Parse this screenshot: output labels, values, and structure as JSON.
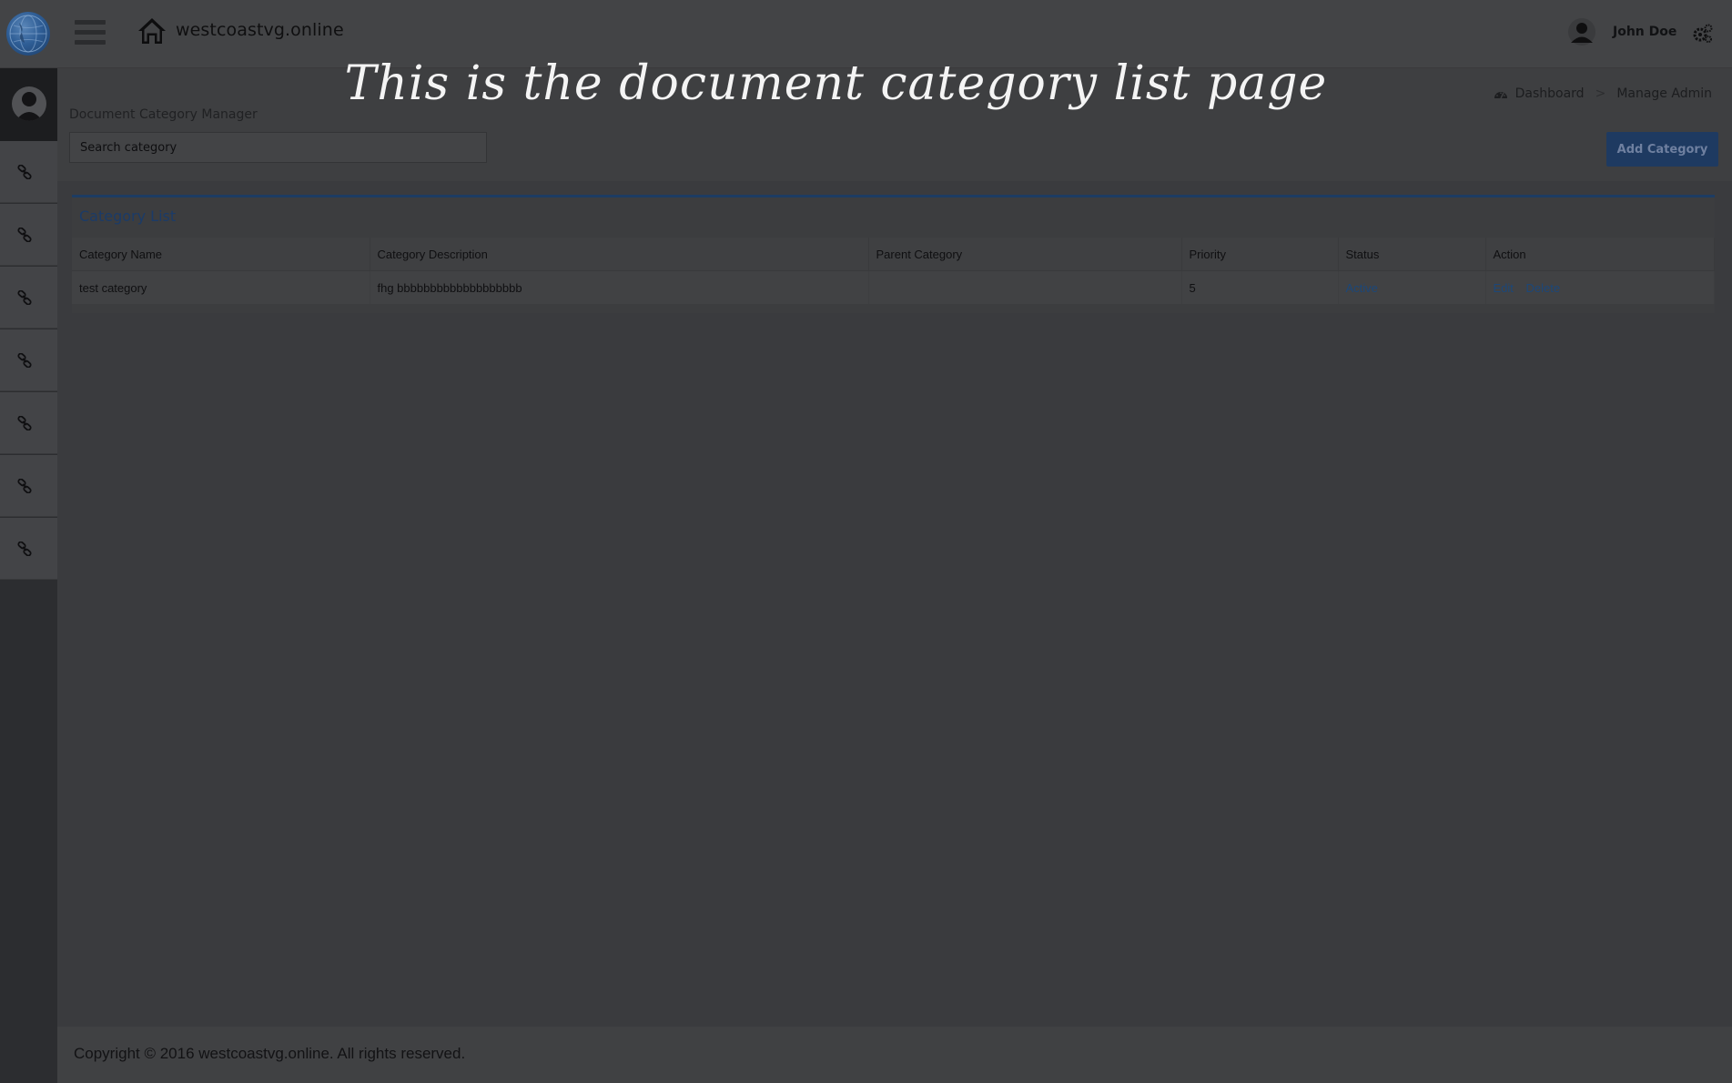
{
  "topbar": {
    "site_title": "westcoastvg.online",
    "user_name": "John Doe"
  },
  "overlay": {
    "heading": "This is the document category list page"
  },
  "header": {
    "page_title": "Document Category Manager",
    "search_placeholder": "Search category",
    "breadcrumb": [
      "Dashboard",
      "Manage Admin"
    ],
    "breadcrumb_separator": ">",
    "add_button_label": "Add Category"
  },
  "sidebar": {
    "items": [
      {
        "icon": "link-icon"
      },
      {
        "icon": "link-icon"
      },
      {
        "icon": "link-icon"
      },
      {
        "icon": "link-icon"
      },
      {
        "icon": "link-icon"
      },
      {
        "icon": "link-icon"
      },
      {
        "icon": "link-icon"
      }
    ]
  },
  "panel": {
    "title": "Category List",
    "columns": [
      "Category Name",
      "Category Description",
      "Parent Category",
      "Priority",
      "Status",
      "Action"
    ],
    "rows": [
      {
        "name": "test category",
        "description": "fhg bbbbbbbbbbbbbbbbbbb",
        "parent": "",
        "priority": "5",
        "status": "Active",
        "edit_label": "Edit",
        "delete_label": "Delete"
      }
    ]
  },
  "footer": {
    "copyright": "Copyright © 2016 westcoastvg.online. All rights reserved."
  },
  "colors": {
    "accent": "#1e3a61",
    "link": "#1c4779"
  }
}
